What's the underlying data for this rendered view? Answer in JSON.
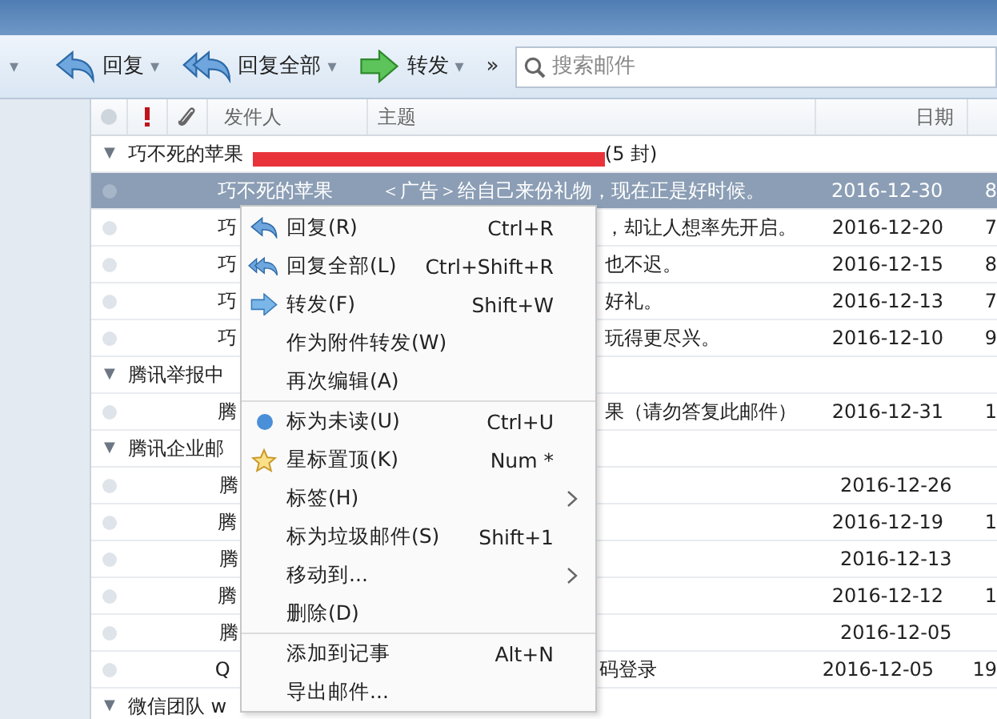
{
  "toolbar": {
    "lead_caret": "▾",
    "buttons": [
      {
        "kind": "reply",
        "label": "回复",
        "caret": "▾"
      },
      {
        "kind": "reply-all",
        "label": "回复全部",
        "caret": "▾"
      },
      {
        "kind": "forward",
        "label": "转发",
        "caret": "▾"
      }
    ],
    "more": "»",
    "search": {
      "placeholder": "搜索邮件"
    }
  },
  "list": {
    "columns": {
      "sender": "发件人",
      "subject": "主题",
      "date": "日期"
    },
    "items": [
      {
        "kind": "group",
        "toggle": "▼",
        "title": "巧不死的苹果",
        "redacted": true,
        "count": "(5 封)"
      },
      {
        "kind": "mail",
        "selected": true,
        "sender": "巧不死的苹果",
        "subject": "＜广告＞给自己来份礼物，现在正是好时候。",
        "date": "2016-12-30",
        "size": "8"
      },
      {
        "kind": "mail",
        "selected": false,
        "sender": "巧",
        "subject": "，却让人想率先开启。",
        "date": "2016-12-20",
        "size": "7"
      },
      {
        "kind": "mail",
        "selected": false,
        "sender": "巧",
        "subject": "也不迟。",
        "date": "2016-12-15",
        "size": "8"
      },
      {
        "kind": "mail",
        "selected": false,
        "sender": "巧",
        "subject": "好礼。",
        "date": "2016-12-13",
        "size": "7"
      },
      {
        "kind": "mail",
        "selected": false,
        "sender": "巧",
        "subject": "玩得更尽兴。",
        "date": "2016-12-10",
        "size": "9"
      },
      {
        "kind": "group",
        "toggle": "▼",
        "title": "腾讯举报中",
        "redacted": false
      },
      {
        "kind": "mail",
        "selected": false,
        "sender": "腾",
        "subject": "果（请勿答复此邮件）",
        "date": "2016-12-31",
        "size": "1"
      },
      {
        "kind": "group",
        "toggle": "▼",
        "title": "腾讯企业邮",
        "redacted": false
      },
      {
        "kind": "mail",
        "selected": false,
        "sender": "腾",
        "date": "2016-12-26"
      },
      {
        "kind": "mail",
        "selected": false,
        "sender": "腾",
        "date": "2016-12-19",
        "size": "1"
      },
      {
        "kind": "mail",
        "selected": false,
        "sender": "腾",
        "date": "2016-12-13"
      },
      {
        "kind": "mail",
        "selected": false,
        "sender": "腾",
        "date": "2016-12-12",
        "size": "1"
      },
      {
        "kind": "mail",
        "selected": false,
        "sender": "腾",
        "date": "2016-12-05"
      },
      {
        "kind": "mail",
        "selected": false,
        "sender": "Q",
        "subject": "码登录",
        "date": "2016-12-05",
        "size": "19"
      },
      {
        "kind": "group",
        "toggle": "▼",
        "title": "微信团队  w",
        "redacted": false
      }
    ]
  },
  "context_menu": {
    "items": [
      {
        "kind": "item",
        "label": "回复(R)",
        "shortcut": "Ctrl+R",
        "submenu": false
      },
      {
        "kind": "item",
        "label": "回复全部(L)",
        "shortcut": "Ctrl+Shift+R",
        "submenu": false
      },
      {
        "kind": "item",
        "label": "转发(F)",
        "shortcut": "Shift+W",
        "submenu": false
      },
      {
        "kind": "item",
        "label": "作为附件转发(W)",
        "submenu": false
      },
      {
        "kind": "item",
        "label": "再次编辑(A)",
        "submenu": false
      },
      {
        "kind": "separator"
      },
      {
        "kind": "item",
        "label": "标为未读(U)",
        "shortcut": "Ctrl+U",
        "submenu": false
      },
      {
        "kind": "item",
        "label": "星标置顶(K)",
        "shortcut": "Num *",
        "submenu": false
      },
      {
        "kind": "item",
        "label": "标签(H)",
        "submenu": true
      },
      {
        "kind": "item",
        "label": "标为垃圾邮件(S)",
        "shortcut": "Shift+1",
        "submenu": false
      },
      {
        "kind": "item",
        "label": "移动到...",
        "submenu": true
      },
      {
        "kind": "item",
        "label": "删除(D)",
        "submenu": false
      },
      {
        "kind": "separator"
      },
      {
        "kind": "item",
        "label": "添加到记事",
        "shortcut": "Alt+N",
        "submenu": false
      },
      {
        "kind": "item",
        "label": "导出邮件...",
        "submenu": false
      }
    ]
  }
}
